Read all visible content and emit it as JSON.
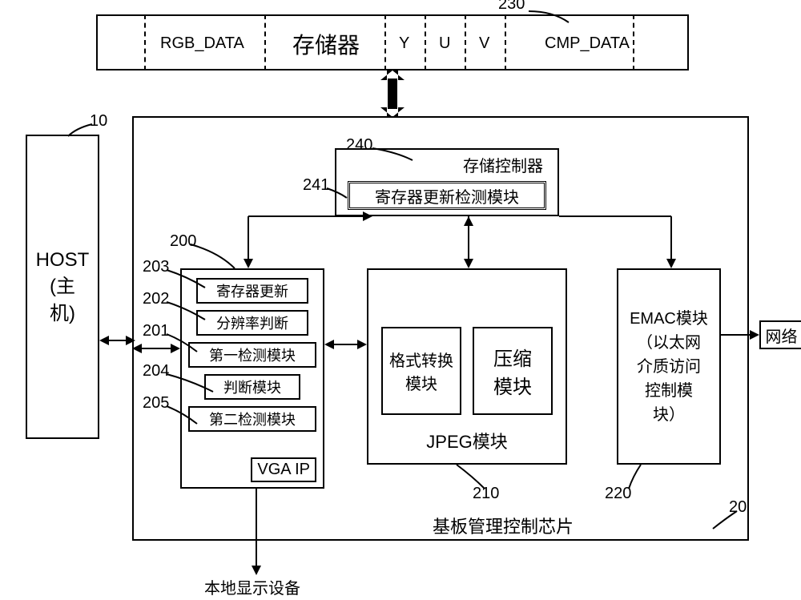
{
  "memory": {
    "title": "存储器",
    "rgb": "RGB_DATA",
    "y": "Y",
    "u": "U",
    "v": "V",
    "cmp": "CMP_DATA",
    "ref": "230"
  },
  "host": {
    "label": "HOST\n(主\n机)",
    "ref": "10"
  },
  "chip": {
    "title": "基板管理控制芯片",
    "ref": "20"
  },
  "memctrl": {
    "title": "存储控制器",
    "submodule": "寄存器更新检测模块",
    "ref": "240",
    "subref": "241"
  },
  "vga": {
    "name": "VGA IP",
    "modules": {
      "reg_update": "寄存器更新",
      "res_judge": "分辨率判断",
      "first_detect": "第一检测模块",
      "judge": "判断模块",
      "second_detect": "第二检测模块"
    },
    "refs": {
      "block": "200",
      "reg_update": "203",
      "res_judge": "202",
      "first_detect": "201",
      "judge": "204",
      "second_detect": "205"
    }
  },
  "jpeg": {
    "title": "JPEG模块",
    "fmt": "格式转换\n模块",
    "compress": "压缩\n模块",
    "ref": "210"
  },
  "emac": {
    "label": "EMAC模块\n（以太网\n介质访问\n控制模\n块）",
    "ref": "220"
  },
  "network": "网络",
  "local_display": "本地显示设备"
}
